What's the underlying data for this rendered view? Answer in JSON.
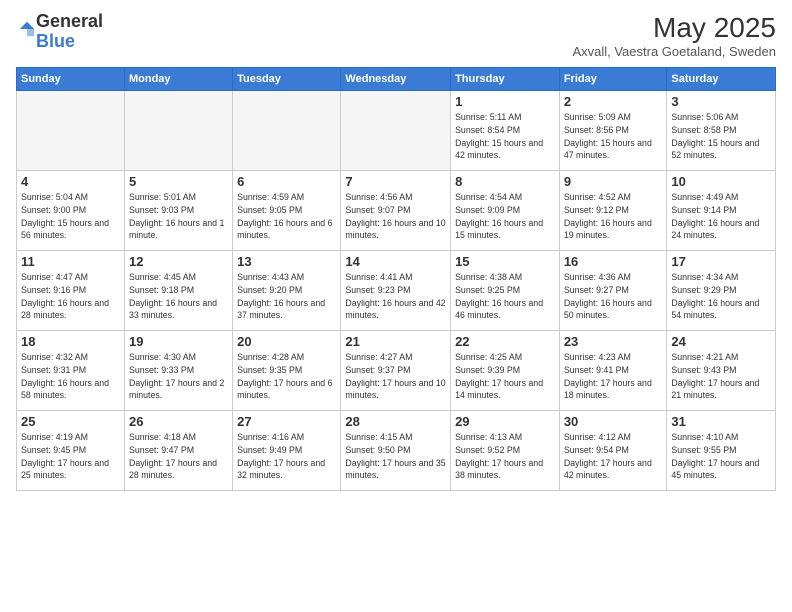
{
  "logo": {
    "general": "General",
    "blue": "Blue"
  },
  "title": "May 2025",
  "location": "Axvall, Vaestra Goetaland, Sweden",
  "days_of_week": [
    "Sunday",
    "Monday",
    "Tuesday",
    "Wednesday",
    "Thursday",
    "Friday",
    "Saturday"
  ],
  "weeks": [
    [
      {
        "day": "",
        "empty": true
      },
      {
        "day": "",
        "empty": true
      },
      {
        "day": "",
        "empty": true
      },
      {
        "day": "",
        "empty": true
      },
      {
        "day": "1",
        "sunrise": "5:11 AM",
        "sunset": "8:54 PM",
        "daylight": "15 hours and 42 minutes."
      },
      {
        "day": "2",
        "sunrise": "5:09 AM",
        "sunset": "8:56 PM",
        "daylight": "15 hours and 47 minutes."
      },
      {
        "day": "3",
        "sunrise": "5:06 AM",
        "sunset": "8:58 PM",
        "daylight": "15 hours and 52 minutes."
      }
    ],
    [
      {
        "day": "4",
        "sunrise": "5:04 AM",
        "sunset": "9:00 PM",
        "daylight": "15 hours and 56 minutes."
      },
      {
        "day": "5",
        "sunrise": "5:01 AM",
        "sunset": "9:03 PM",
        "daylight": "16 hours and 1 minute."
      },
      {
        "day": "6",
        "sunrise": "4:59 AM",
        "sunset": "9:05 PM",
        "daylight": "16 hours and 6 minutes."
      },
      {
        "day": "7",
        "sunrise": "4:56 AM",
        "sunset": "9:07 PM",
        "daylight": "16 hours and 10 minutes."
      },
      {
        "day": "8",
        "sunrise": "4:54 AM",
        "sunset": "9:09 PM",
        "daylight": "16 hours and 15 minutes."
      },
      {
        "day": "9",
        "sunrise": "4:52 AM",
        "sunset": "9:12 PM",
        "daylight": "16 hours and 19 minutes."
      },
      {
        "day": "10",
        "sunrise": "4:49 AM",
        "sunset": "9:14 PM",
        "daylight": "16 hours and 24 minutes."
      }
    ],
    [
      {
        "day": "11",
        "sunrise": "4:47 AM",
        "sunset": "9:16 PM",
        "daylight": "16 hours and 28 minutes."
      },
      {
        "day": "12",
        "sunrise": "4:45 AM",
        "sunset": "9:18 PM",
        "daylight": "16 hours and 33 minutes."
      },
      {
        "day": "13",
        "sunrise": "4:43 AM",
        "sunset": "9:20 PM",
        "daylight": "16 hours and 37 minutes."
      },
      {
        "day": "14",
        "sunrise": "4:41 AM",
        "sunset": "9:23 PM",
        "daylight": "16 hours and 42 minutes."
      },
      {
        "day": "15",
        "sunrise": "4:38 AM",
        "sunset": "9:25 PM",
        "daylight": "16 hours and 46 minutes."
      },
      {
        "day": "16",
        "sunrise": "4:36 AM",
        "sunset": "9:27 PM",
        "daylight": "16 hours and 50 minutes."
      },
      {
        "day": "17",
        "sunrise": "4:34 AM",
        "sunset": "9:29 PM",
        "daylight": "16 hours and 54 minutes."
      }
    ],
    [
      {
        "day": "18",
        "sunrise": "4:32 AM",
        "sunset": "9:31 PM",
        "daylight": "16 hours and 58 minutes."
      },
      {
        "day": "19",
        "sunrise": "4:30 AM",
        "sunset": "9:33 PM",
        "daylight": "17 hours and 2 minutes."
      },
      {
        "day": "20",
        "sunrise": "4:28 AM",
        "sunset": "9:35 PM",
        "daylight": "17 hours and 6 minutes."
      },
      {
        "day": "21",
        "sunrise": "4:27 AM",
        "sunset": "9:37 PM",
        "daylight": "17 hours and 10 minutes."
      },
      {
        "day": "22",
        "sunrise": "4:25 AM",
        "sunset": "9:39 PM",
        "daylight": "17 hours and 14 minutes."
      },
      {
        "day": "23",
        "sunrise": "4:23 AM",
        "sunset": "9:41 PM",
        "daylight": "17 hours and 18 minutes."
      },
      {
        "day": "24",
        "sunrise": "4:21 AM",
        "sunset": "9:43 PM",
        "daylight": "17 hours and 21 minutes."
      }
    ],
    [
      {
        "day": "25",
        "sunrise": "4:19 AM",
        "sunset": "9:45 PM",
        "daylight": "17 hours and 25 minutes."
      },
      {
        "day": "26",
        "sunrise": "4:18 AM",
        "sunset": "9:47 PM",
        "daylight": "17 hours and 28 minutes."
      },
      {
        "day": "27",
        "sunrise": "4:16 AM",
        "sunset": "9:49 PM",
        "daylight": "17 hours and 32 minutes."
      },
      {
        "day": "28",
        "sunrise": "4:15 AM",
        "sunset": "9:50 PM",
        "daylight": "17 hours and 35 minutes."
      },
      {
        "day": "29",
        "sunrise": "4:13 AM",
        "sunset": "9:52 PM",
        "daylight": "17 hours and 38 minutes."
      },
      {
        "day": "30",
        "sunrise": "4:12 AM",
        "sunset": "9:54 PM",
        "daylight": "17 hours and 42 minutes."
      },
      {
        "day": "31",
        "sunrise": "4:10 AM",
        "sunset": "9:55 PM",
        "daylight": "17 hours and 45 minutes."
      }
    ]
  ],
  "labels": {
    "sunrise_prefix": "Sunrise: ",
    "sunset_prefix": "Sunset: ",
    "daylight_prefix": "Daylight: "
  }
}
